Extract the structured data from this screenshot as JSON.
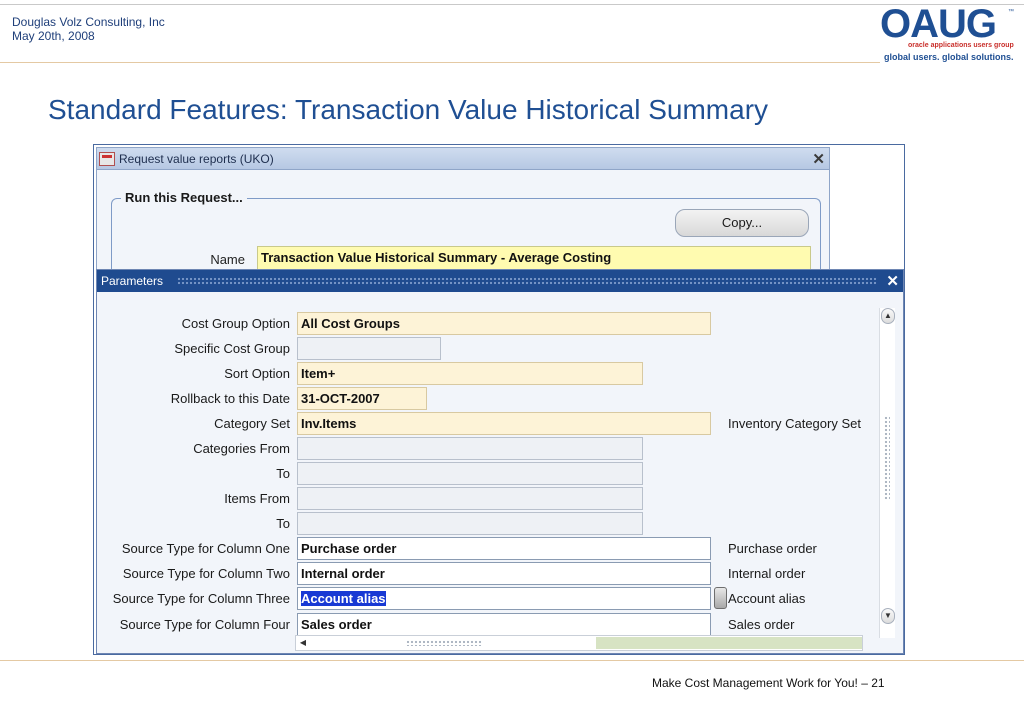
{
  "slide": {
    "company": "Douglas Volz Consulting, Inc",
    "date": "May 20th, 2008",
    "logo_mark": "OAUG",
    "logo_tm": "™",
    "logo_sub": "oracle applications users group",
    "logo_slogan": "global users. global solutions.",
    "title": "Standard Features:  Transaction Value Historical Summary",
    "footer": "Make Cost Management Work for You! – 21"
  },
  "request_window": {
    "title": "Request value reports (UKO)",
    "close_glyph": "✕",
    "group_label": "Run this Request...",
    "copy_label": "Copy...",
    "name_label": "Name",
    "name_value": "Transaction Value Historical Summary - Average Costing"
  },
  "parameters_window": {
    "title": "Parameters",
    "close_glyph": "✕",
    "rows": [
      {
        "label": "Cost Group Option",
        "value": "All Cost Groups",
        "desc": ""
      },
      {
        "label": "Specific Cost Group",
        "value": "",
        "desc": ""
      },
      {
        "label": "Sort Option",
        "value": "Item+",
        "desc": ""
      },
      {
        "label": "Rollback to this Date",
        "value": "31-OCT-2007",
        "desc": ""
      },
      {
        "label": "Category Set",
        "value": "Inv.Items",
        "desc": "Inventory Category Set"
      },
      {
        "label": "Categories From",
        "value": "",
        "desc": ""
      },
      {
        "label": "To",
        "value": "",
        "desc": ""
      },
      {
        "label": "Items From",
        "value": "",
        "desc": ""
      },
      {
        "label": "To",
        "value": "",
        "desc": ""
      },
      {
        "label": "Source Type for Column One",
        "value": "Purchase order",
        "desc": "Purchase order"
      },
      {
        "label": "Source Type for Column Two",
        "value": "Internal order",
        "desc": "Internal order"
      },
      {
        "label": "Source Type for Column Three",
        "value": "Account alias",
        "desc": "Account alias"
      },
      {
        "label": "Source Type for Column Four",
        "value": "Sales order",
        "desc": "Sales order"
      }
    ],
    "scroll_up_glyph": "▲",
    "scroll_down_glyph": "▼",
    "scroll_left_glyph": "◀"
  },
  "colors": {
    "title_blue": "#1f4f93",
    "required_field": "#fdf3d7",
    "name_field": "#fffbb0",
    "selection": "#1839d4"
  }
}
